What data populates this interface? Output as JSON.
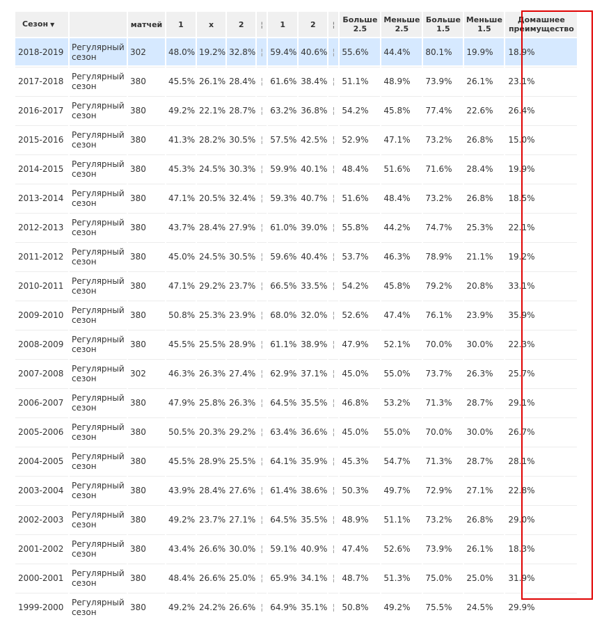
{
  "table": {
    "headers": {
      "season": "Сезон",
      "sort_arrow": "▼",
      "type": "",
      "matches": "матчей",
      "h1": "1",
      "hx": "x",
      "h2": "2",
      "sep1": "¦",
      "ht1": "1",
      "ht2": "2",
      "sep2": "¦",
      "over25": "Больше 2.5",
      "under25": "Меньше 2.5",
      "over15": "Больше 1.5",
      "under15": "Меньше 1.5",
      "home_adv": "Домашнее преимущество"
    },
    "rows": [
      {
        "season": "2018-2019",
        "type": "Регулярный сезон",
        "matches": "302",
        "p1": "48.0%",
        "px": "19.2%",
        "p2": "32.8%",
        "sep1": "¦",
        "q1": "59.4%",
        "q2": "40.6%",
        "sep2": "¦",
        "o25": "55.6%",
        "u25": "44.4%",
        "o15": "80.1%",
        "u15": "19.9%",
        "adv": "18.9%"
      },
      {
        "season": "2017-2018",
        "type": "Регулярный сезон",
        "matches": "380",
        "p1": "45.5%",
        "px": "26.1%",
        "p2": "28.4%",
        "sep1": "¦",
        "q1": "61.6%",
        "q2": "38.4%",
        "sep2": "¦",
        "o25": "51.1%",
        "u25": "48.9%",
        "o15": "73.9%",
        "u15": "26.1%",
        "adv": "23.1%"
      },
      {
        "season": "2016-2017",
        "type": "Регулярный сезон",
        "matches": "380",
        "p1": "49.2%",
        "px": "22.1%",
        "p2": "28.7%",
        "sep1": "¦",
        "q1": "63.2%",
        "q2": "36.8%",
        "sep2": "¦",
        "o25": "54.2%",
        "u25": "45.8%",
        "o15": "77.4%",
        "u15": "22.6%",
        "adv": "26.4%"
      },
      {
        "season": "2015-2016",
        "type": "Регулярный сезон",
        "matches": "380",
        "p1": "41.3%",
        "px": "28.2%",
        "p2": "30.5%",
        "sep1": "¦",
        "q1": "57.5%",
        "q2": "42.5%",
        "sep2": "¦",
        "o25": "52.9%",
        "u25": "47.1%",
        "o15": "73.2%",
        "u15": "26.8%",
        "adv": "15.0%"
      },
      {
        "season": "2014-2015",
        "type": "Регулярный сезон",
        "matches": "380",
        "p1": "45.3%",
        "px": "24.5%",
        "p2": "30.3%",
        "sep1": "¦",
        "q1": "59.9%",
        "q2": "40.1%",
        "sep2": "¦",
        "o25": "48.4%",
        "u25": "51.6%",
        "o15": "71.6%",
        "u15": "28.4%",
        "adv": "19.9%"
      },
      {
        "season": "2013-2014",
        "type": "Регулярный сезон",
        "matches": "380",
        "p1": "47.1%",
        "px": "20.5%",
        "p2": "32.4%",
        "sep1": "¦",
        "q1": "59.3%",
        "q2": "40.7%",
        "sep2": "¦",
        "o25": "51.6%",
        "u25": "48.4%",
        "o15": "73.2%",
        "u15": "26.8%",
        "adv": "18.5%"
      },
      {
        "season": "2012-2013",
        "type": "Регулярный сезон",
        "matches": "380",
        "p1": "43.7%",
        "px": "28.4%",
        "p2": "27.9%",
        "sep1": "¦",
        "q1": "61.0%",
        "q2": "39.0%",
        "sep2": "¦",
        "o25": "55.8%",
        "u25": "44.2%",
        "o15": "74.7%",
        "u15": "25.3%",
        "adv": "22.1%"
      },
      {
        "season": "2011-2012",
        "type": "Регулярный сезон",
        "matches": "380",
        "p1": "45.0%",
        "px": "24.5%",
        "p2": "30.5%",
        "sep1": "¦",
        "q1": "59.6%",
        "q2": "40.4%",
        "sep2": "¦",
        "o25": "53.7%",
        "u25": "46.3%",
        "o15": "78.9%",
        "u15": "21.1%",
        "adv": "19.2%"
      },
      {
        "season": "2010-2011",
        "type": "Регулярный сезон",
        "matches": "380",
        "p1": "47.1%",
        "px": "29.2%",
        "p2": "23.7%",
        "sep1": "¦",
        "q1": "66.5%",
        "q2": "33.5%",
        "sep2": "¦",
        "o25": "54.2%",
        "u25": "45.8%",
        "o15": "79.2%",
        "u15": "20.8%",
        "adv": "33.1%"
      },
      {
        "season": "2009-2010",
        "type": "Регулярный сезон",
        "matches": "380",
        "p1": "50.8%",
        "px": "25.3%",
        "p2": "23.9%",
        "sep1": "¦",
        "q1": "68.0%",
        "q2": "32.0%",
        "sep2": "¦",
        "o25": "52.6%",
        "u25": "47.4%",
        "o15": "76.1%",
        "u15": "23.9%",
        "adv": "35.9%"
      },
      {
        "season": "2008-2009",
        "type": "Регулярный сезон",
        "matches": "380",
        "p1": "45.5%",
        "px": "25.5%",
        "p2": "28.9%",
        "sep1": "¦",
        "q1": "61.1%",
        "q2": "38.9%",
        "sep2": "¦",
        "o25": "47.9%",
        "u25": "52.1%",
        "o15": "70.0%",
        "u15": "30.0%",
        "adv": "22.3%"
      },
      {
        "season": "2007-2008",
        "type": "Регулярный сезон",
        "matches": "302",
        "p1": "46.3%",
        "px": "26.3%",
        "p2": "27.4%",
        "sep1": "¦",
        "q1": "62.9%",
        "q2": "37.1%",
        "sep2": "¦",
        "o25": "45.0%",
        "u25": "55.0%",
        "o15": "73.7%",
        "u15": "26.3%",
        "adv": "25.7%"
      },
      {
        "season": "2006-2007",
        "type": "Регулярный сезон",
        "matches": "380",
        "p1": "47.9%",
        "px": "25.8%",
        "p2": "26.3%",
        "sep1": "¦",
        "q1": "64.5%",
        "q2": "35.5%",
        "sep2": "¦",
        "o25": "46.8%",
        "u25": "53.2%",
        "o15": "71.3%",
        "u15": "28.7%",
        "adv": "29.1%"
      },
      {
        "season": "2005-2006",
        "type": "Регулярный сезон",
        "matches": "380",
        "p1": "50.5%",
        "px": "20.3%",
        "p2": "29.2%",
        "sep1": "¦",
        "q1": "63.4%",
        "q2": "36.6%",
        "sep2": "¦",
        "o25": "45.0%",
        "u25": "55.0%",
        "o15": "70.0%",
        "u15": "30.0%",
        "adv": "26.7%"
      },
      {
        "season": "2004-2005",
        "type": "Регулярный сезон",
        "matches": "380",
        "p1": "45.5%",
        "px": "28.9%",
        "p2": "25.5%",
        "sep1": "¦",
        "q1": "64.1%",
        "q2": "35.9%",
        "sep2": "¦",
        "o25": "45.3%",
        "u25": "54.7%",
        "o15": "71.3%",
        "u15": "28.7%",
        "adv": "28.1%"
      },
      {
        "season": "2003-2004",
        "type": "Регулярный сезон",
        "matches": "380",
        "p1": "43.9%",
        "px": "28.4%",
        "p2": "27.6%",
        "sep1": "¦",
        "q1": "61.4%",
        "q2": "38.6%",
        "sep2": "¦",
        "o25": "50.3%",
        "u25": "49.7%",
        "o15": "72.9%",
        "u15": "27.1%",
        "adv": "22.8%"
      },
      {
        "season": "2002-2003",
        "type": "Регулярный сезон",
        "matches": "380",
        "p1": "49.2%",
        "px": "23.7%",
        "p2": "27.1%",
        "sep1": "¦",
        "q1": "64.5%",
        "q2": "35.5%",
        "sep2": "¦",
        "o25": "48.9%",
        "u25": "51.1%",
        "o15": "73.2%",
        "u15": "26.8%",
        "adv": "29.0%"
      },
      {
        "season": "2001-2002",
        "type": "Регулярный сезон",
        "matches": "380",
        "p1": "43.4%",
        "px": "26.6%",
        "p2": "30.0%",
        "sep1": "¦",
        "q1": "59.1%",
        "q2": "40.9%",
        "sep2": "¦",
        "o25": "47.4%",
        "u25": "52.6%",
        "o15": "73.9%",
        "u15": "26.1%",
        "adv": "18.3%"
      },
      {
        "season": "2000-2001",
        "type": "Регулярный сезон",
        "matches": "380",
        "p1": "48.4%",
        "px": "26.6%",
        "p2": "25.0%",
        "sep1": "¦",
        "q1": "65.9%",
        "q2": "34.1%",
        "sep2": "¦",
        "o25": "48.7%",
        "u25": "51.3%",
        "o15": "75.0%",
        "u15": "25.0%",
        "adv": "31.9%"
      },
      {
        "season": "1999-2000",
        "type": "Регулярный сезон",
        "matches": "380",
        "p1": "49.2%",
        "px": "24.2%",
        "p2": "26.6%",
        "sep1": "¦",
        "q1": "64.9%",
        "q2": "35.1%",
        "sep2": "¦",
        "o25": "50.8%",
        "u25": "49.2%",
        "o15": "75.5%",
        "u15": "24.5%",
        "adv": "29.9%"
      }
    ],
    "highlighted_row": 0,
    "highlight_color": "#d6e9ff",
    "annotation_color": "#e00000"
  }
}
